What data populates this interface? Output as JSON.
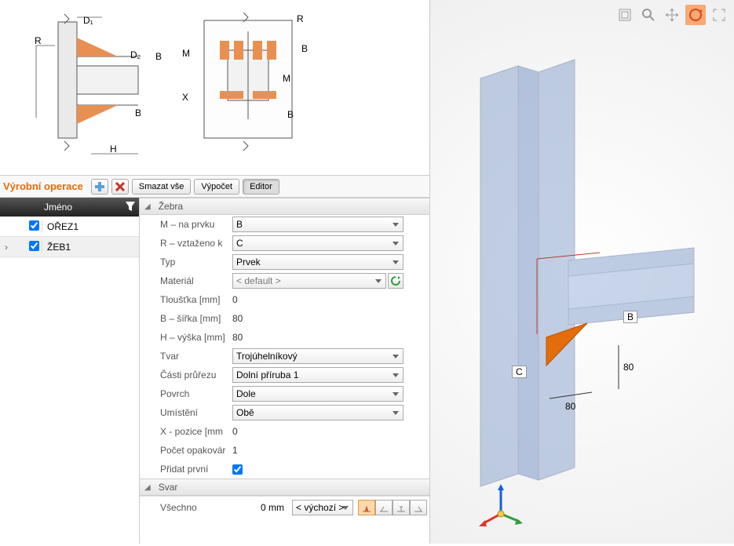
{
  "diagram": {
    "labels": {
      "R": "R",
      "D1": "D₁",
      "D2": "D₂",
      "B": "B",
      "H": "H",
      "M": "M",
      "X": "X"
    }
  },
  "toolbar": {
    "title": "Výrobní operace",
    "deleteAll": "Smazat vše",
    "compute": "Výpočet",
    "editor": "Editor"
  },
  "opList": {
    "header": "Jméno",
    "rows": [
      {
        "name": "OŘEZ1",
        "checked": true,
        "selected": false
      },
      {
        "name": "ŽEB1",
        "checked": true,
        "selected": true
      }
    ]
  },
  "groups": {
    "zebra": "Žebra",
    "svar": "Svar"
  },
  "props": {
    "mOnElement": {
      "label": "M – na prvku",
      "value": "B"
    },
    "rRelatedTo": {
      "label": "R – vztaženo k",
      "value": "C"
    },
    "type": {
      "label": "Typ",
      "value": "Prvek"
    },
    "material": {
      "label": "Materiál",
      "value": "< default >"
    },
    "thickness": {
      "label": "Tloušťka [mm]",
      "value": "0"
    },
    "bWidth": {
      "label": "B – šířka  [mm]",
      "value": "80"
    },
    "hHeight": {
      "label": "H – výška  [mm]",
      "value": "80"
    },
    "shape": {
      "label": "Tvar",
      "value": "Trojúhelníkový"
    },
    "sectionPart": {
      "label": "Části průřezu",
      "value": "Dolní příruba 1"
    },
    "surface": {
      "label": "Povrch",
      "value": "Dole"
    },
    "placement": {
      "label": "Umístění",
      "value": "Obě"
    },
    "xPos": {
      "label": "X - pozice [mm",
      "value": "0"
    },
    "repeatCount": {
      "label": "Počet opakovár",
      "value": "1"
    },
    "addFirst": {
      "label": "Přidat první",
      "checked": true
    }
  },
  "svar": {
    "all": "Všechno",
    "value": "0 mm",
    "mode": "< výchozí >"
  },
  "viewport": {
    "labels": {
      "B": "B",
      "C": "C"
    },
    "dims": {
      "d1": "80",
      "d2": "80"
    }
  },
  "icons": {
    "add": "add-icon",
    "remove": "remove-icon",
    "filter": "filter-icon",
    "reload": "reload-icon",
    "weldA": "weld-fillet-both-icon",
    "weldB": "weld-fillet-left-icon",
    "weldC": "weld-butt-icon",
    "weldD": "weld-fillet-right-icon",
    "zoomFit": "zoom-fit-icon",
    "zoom": "magnifier-icon",
    "pan": "move-icon",
    "orbit": "orbit-icon",
    "fullscreen": "fullscreen-icon"
  }
}
